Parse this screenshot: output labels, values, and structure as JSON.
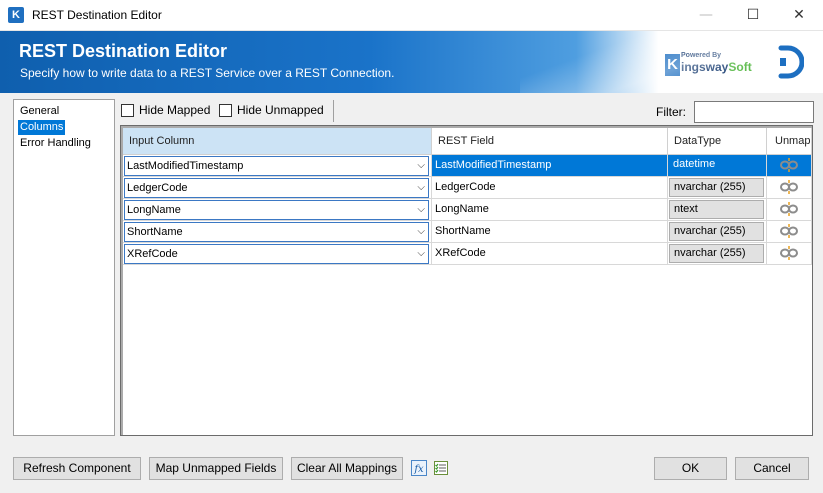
{
  "window": {
    "title": "REST Destination Editor",
    "app_icon": "K",
    "minimize": "—",
    "maximize": "☐",
    "close": "✕"
  },
  "banner": {
    "title": "REST Destination Editor",
    "subtitle": "Specify how to write data to a REST Service over a REST Connection.",
    "logo_powered": "Powered By",
    "logo_k": "K",
    "logo_name_a": "ingsway",
    "logo_name_b": "Soft",
    "colors": {
      "blue": "#1a73c9",
      "green": "#58b947",
      "navy": "#1b3f73"
    }
  },
  "nav": {
    "items": [
      {
        "label": "General"
      },
      {
        "label": "Columns"
      },
      {
        "label": "Error Handling"
      }
    ],
    "selected": "Columns"
  },
  "toolbar": {
    "hide_mapped": "Hide Mapped",
    "hide_unmapped": "Hide Unmapped",
    "filter_label": "Filter:",
    "filter_value": ""
  },
  "grid": {
    "headers": {
      "input": "Input Column",
      "field": "REST Field",
      "type": "DataType",
      "unmap": "Unmap"
    },
    "rows": [
      {
        "input": "LastModifiedTimestamp",
        "field": "LastModifiedTimestamp",
        "type": "datetime",
        "selected": true
      },
      {
        "input": "LedgerCode",
        "field": "LedgerCode",
        "type": "nvarchar (255)"
      },
      {
        "input": "LongName",
        "field": "LongName",
        "type": "ntext"
      },
      {
        "input": "ShortName",
        "field": "ShortName",
        "type": "nvarchar (255)"
      },
      {
        "input": "XRefCode",
        "field": "XRefCode",
        "type": "nvarchar (255)"
      }
    ]
  },
  "buttons": {
    "refresh": "Refresh Component",
    "map_unmapped": "Map Unmapped Fields",
    "clear_all": "Clear All Mappings",
    "ok": "OK",
    "cancel": "Cancel"
  },
  "icons": {
    "expression": "fx",
    "checklist": "checklist-icon",
    "unmap": "unlink-icon"
  }
}
